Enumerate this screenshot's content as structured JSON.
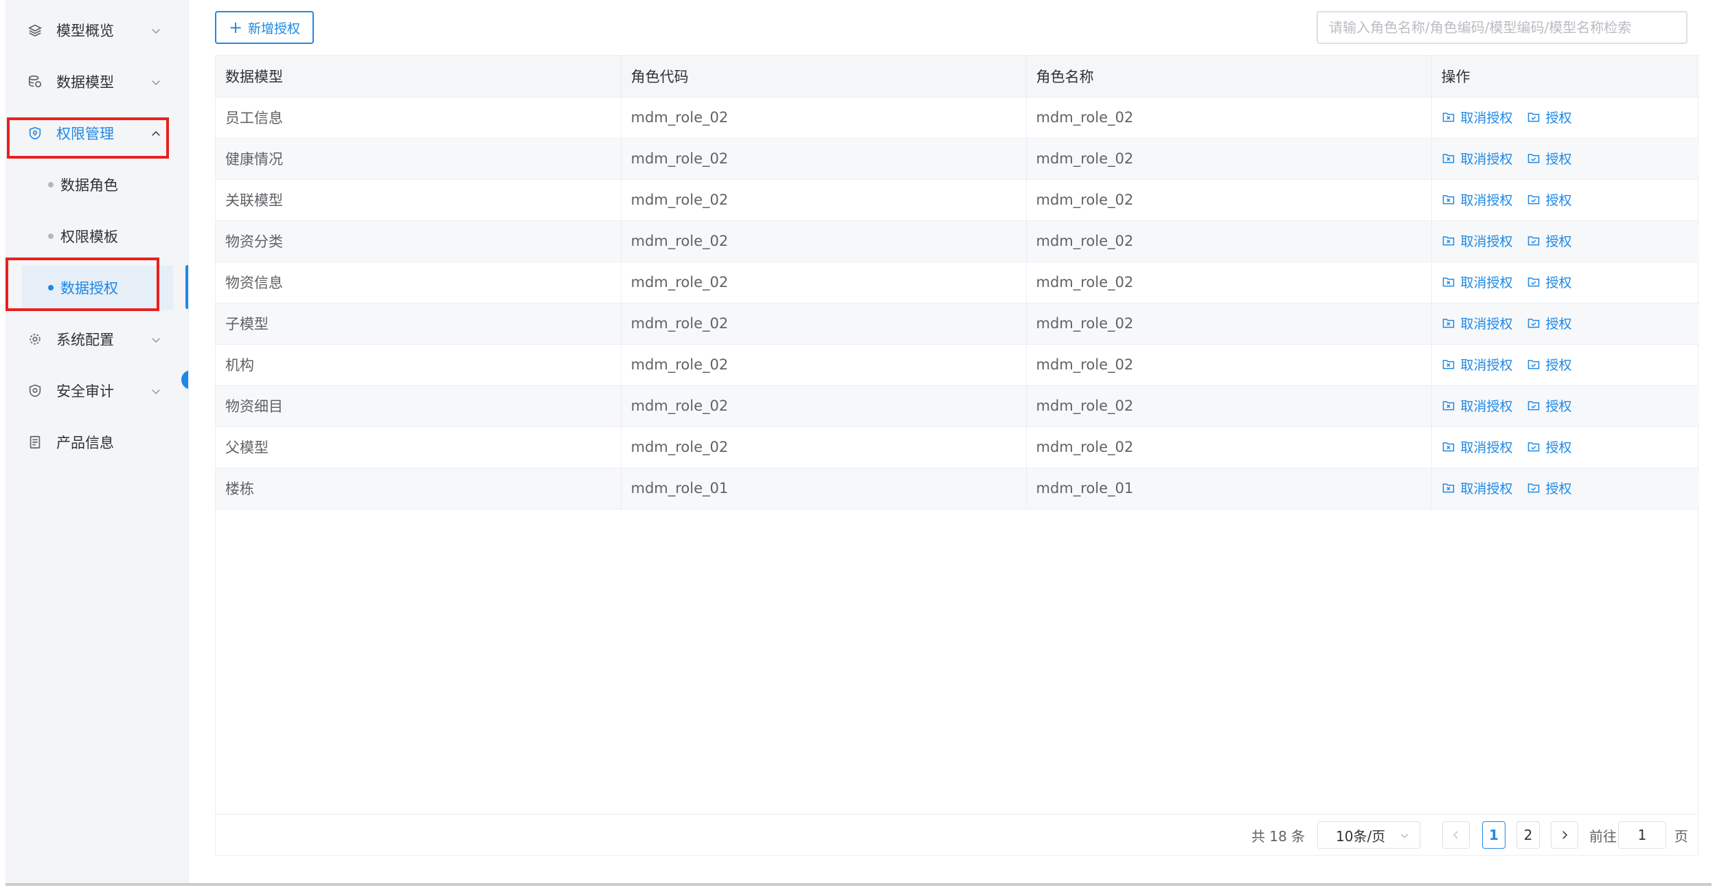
{
  "sidebar": {
    "items": [
      {
        "label": "模型概览",
        "icon": "layers-icon"
      },
      {
        "label": "数据模型",
        "icon": "database-icon"
      },
      {
        "label": "权限管理",
        "icon": "shield-icon"
      },
      {
        "label": "系统配置",
        "icon": "gear-icon"
      },
      {
        "label": "安全审计",
        "icon": "audit-shield-icon"
      },
      {
        "label": "产品信息",
        "icon": "document-icon"
      }
    ],
    "submenu": [
      {
        "label": "数据角色"
      },
      {
        "label": "权限模板"
      },
      {
        "label": "数据授权"
      }
    ],
    "active_submenu": "数据授权"
  },
  "toolbar": {
    "add_label": "新增授权",
    "search_placeholder": "请输入角色名称/角色编码/模型编码/模型名称检索"
  },
  "table": {
    "headers": [
      "数据模型",
      "角色代码",
      "角色名称",
      "操作"
    ],
    "rows": [
      {
        "model": "员工信息",
        "code": "mdm_role_02",
        "name": "mdm_role_02"
      },
      {
        "model": "健康情况",
        "code": "mdm_role_02",
        "name": "mdm_role_02"
      },
      {
        "model": "关联模型",
        "code": "mdm_role_02",
        "name": "mdm_role_02"
      },
      {
        "model": "物资分类",
        "code": "mdm_role_02",
        "name": "mdm_role_02"
      },
      {
        "model": "物资信息",
        "code": "mdm_role_02",
        "name": "mdm_role_02"
      },
      {
        "model": "子模型",
        "code": "mdm_role_02",
        "name": "mdm_role_02"
      },
      {
        "model": "机构",
        "code": "mdm_role_02",
        "name": "mdm_role_02"
      },
      {
        "model": "物资细目",
        "code": "mdm_role_02",
        "name": "mdm_role_02"
      },
      {
        "model": "父模型",
        "code": "mdm_role_02",
        "name": "mdm_role_02"
      },
      {
        "model": "楼栋",
        "code": "mdm_role_01",
        "name": "mdm_role_01"
      }
    ],
    "actions": {
      "revoke": "取消授权",
      "grant": "授权"
    }
  },
  "pagination": {
    "total_text": "共 18 条",
    "page_size": "10条/页",
    "pages": [
      "1",
      "2"
    ],
    "current": "1",
    "goto_label": "前往",
    "goto_value": "1",
    "goto_unit": "页"
  },
  "colors": {
    "accent": "#1e88e5",
    "highlight": "#e82020"
  }
}
